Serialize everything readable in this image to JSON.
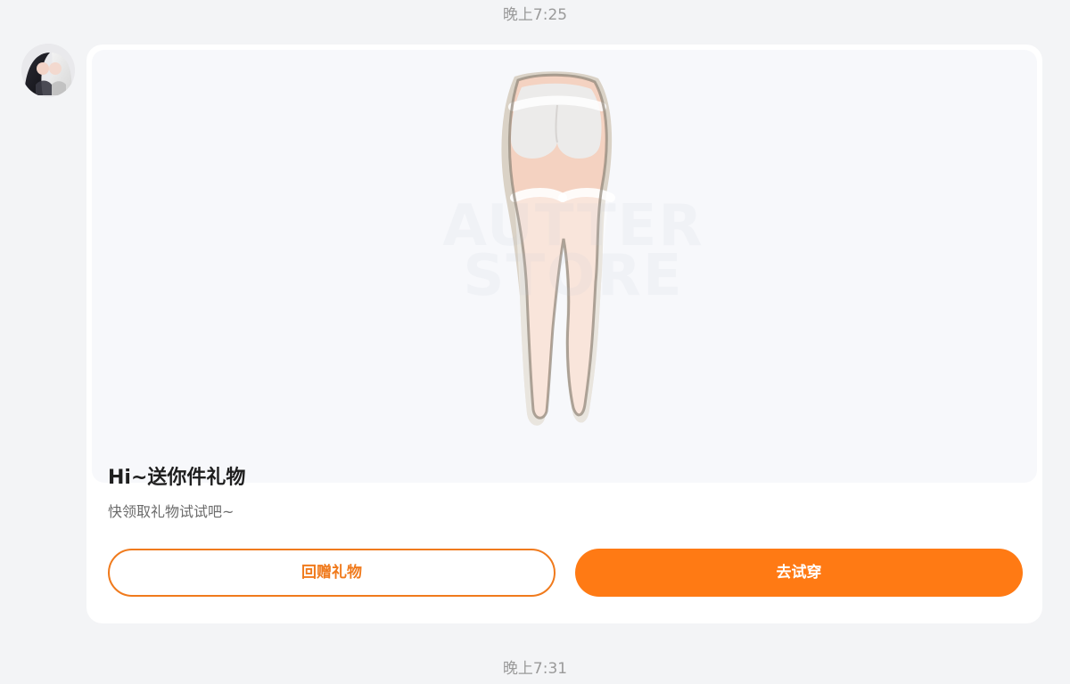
{
  "chat": {
    "timestamps": {
      "top": "晚上7:25",
      "bottom": "晚上7:31"
    },
    "message": {
      "avatar_icon": "user-avatar",
      "gift_card": {
        "title": "Hi~送你件礼物",
        "subtitle": "快领取礼物试试吧~",
        "buttons": {
          "return_gift": "回赠礼物",
          "try_on": "去试穿"
        },
        "image": {
          "watermark_lines": [
            "AUTTER",
            "STORE"
          ]
        },
        "colors": {
          "accent": "#ff7a14",
          "accent_border": "#f07a1c",
          "background": "#f3f4f6",
          "card": "#ffffff",
          "media_bg": "#f7f8fb"
        }
      }
    }
  }
}
